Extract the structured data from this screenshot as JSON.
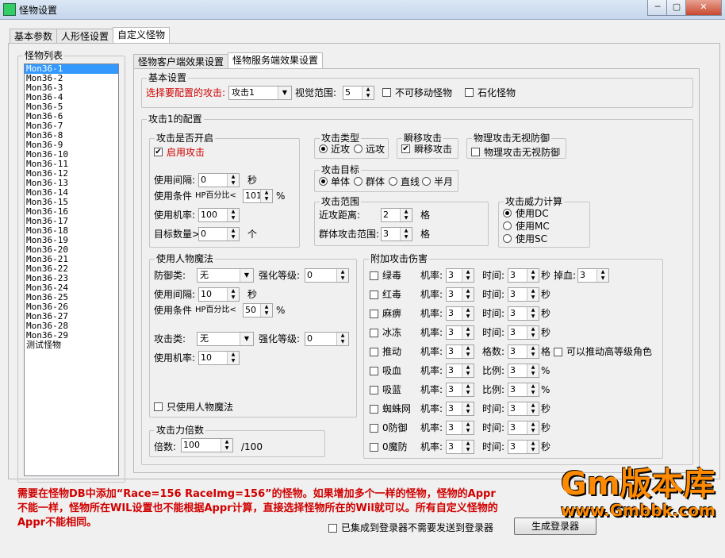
{
  "window": {
    "title": "怪物设置"
  },
  "main_tabs": [
    "基本参数",
    "人形怪设置",
    "自定义怪物"
  ],
  "monster_list": {
    "label": "怪物列表",
    "items": [
      "Mon36-1",
      "Mon36-2",
      "Mon36-3",
      "Mon36-4",
      "Mon36-5",
      "Mon36-6",
      "Mon36-7",
      "Mon36-8",
      "Mon36-9",
      "Mon36-10",
      "Mon36-11",
      "Mon36-12",
      "Mon36-13",
      "Mon36-14",
      "Mon36-15",
      "Mon36-16",
      "Mon36-17",
      "Mon36-18",
      "Mon36-19",
      "Mon36-20",
      "Mon36-21",
      "Mon36-22",
      "Mon36-23",
      "Mon36-24",
      "Mon36-25",
      "Mon36-26",
      "Mon36-27",
      "Mon36-28",
      "Mon36-29",
      "测试怪物"
    ]
  },
  "sub_tabs": [
    "怪物客户端效果设置",
    "怪物服务端效果设置"
  ],
  "basic": {
    "label": "基本设置",
    "select_attack_label": "选择要配置的攻击:",
    "select_attack_value": "攻击1",
    "vision_label": "视觉范围:",
    "vision_value": "5",
    "immobile_label": "不可移动怪物",
    "stone_label": "石化怪物"
  },
  "attack_config": {
    "label": "攻击1的配置",
    "enable_group": {
      "label": "攻击是否开启",
      "enable_label": "启用攻击",
      "interval_label": "使用间隔:",
      "interval_value": "0",
      "interval_unit": "秒",
      "cond_label": "使用条件",
      "cond_mid": "HP百分比<",
      "cond_value": "101",
      "cond_unit": "%",
      "rate_label": "使用机率:",
      "rate_value": "100",
      "targets_label": "目标数量>",
      "targets_value": "0",
      "targets_unit": "个"
    },
    "attack_type": {
      "label": "攻击类型",
      "melee": "近攻",
      "ranged": "远攻"
    },
    "teleport": {
      "label": "瞬移攻击",
      "check_label": "瞬移攻击"
    },
    "ignore_def": {
      "label": "物理攻击无视防御",
      "check_label": "物理攻击无视防御"
    },
    "attack_target": {
      "label": "攻击目标",
      "options": [
        "单体",
        "群体",
        "直线",
        "半月"
      ]
    },
    "attack_range": {
      "label": "攻击范围",
      "near_label": "近攻距离:",
      "near_value": "2",
      "near_unit": "格",
      "group_label": "群体攻击范围:",
      "group_value": "3",
      "group_unit": "格"
    },
    "power": {
      "label": "攻击威力计算",
      "options": [
        "使用DC",
        "使用MC",
        "使用SC"
      ]
    },
    "magic": {
      "label": "使用人物魔法",
      "def_label": "防御类:",
      "def_value": "无",
      "enh1_label": "强化等级:",
      "enh1_value": "0",
      "interval_label": "使用间隔:",
      "interval_value": "10",
      "interval_unit": "秒",
      "cond_label": "使用条件",
      "cond_mid": "HP百分比<",
      "cond_value": "50",
      "cond_unit": "%",
      "atk_label": "攻击类:",
      "atk_value": "无",
      "enh2_label": "强化等级:",
      "enh2_value": "0",
      "rate_label": "使用机率:",
      "rate_value": "10",
      "only_label": "只使用人物魔法"
    },
    "extra": {
      "label": "附加攻击伤害",
      "rows": [
        {
          "name": "绿毒",
          "rate_label": "机率:",
          "rate": "3",
          "l2": "时间:",
          "v2": "3",
          "u2": "秒",
          "l3": "掉血:",
          "v3": "3"
        },
        {
          "name": "红毒",
          "rate_label": "机率:",
          "rate": "3",
          "l2": "时间:",
          "v2": "3",
          "u2": "秒"
        },
        {
          "name": "麻痹",
          "rate_label": "机率:",
          "rate": "3",
          "l2": "时间:",
          "v2": "3",
          "u2": "秒"
        },
        {
          "name": "冰冻",
          "rate_label": "机率:",
          "rate": "3",
          "l2": "时间:",
          "v2": "3",
          "u2": "秒"
        },
        {
          "name": "推动",
          "rate_label": "机率:",
          "rate": "3",
          "l2": "格数:",
          "v2": "3",
          "u2": "格",
          "extra_check": "可以推动高等级角色"
        },
        {
          "name": "吸血",
          "rate_label": "机率:",
          "rate": "3",
          "l2": "比例:",
          "v2": "3",
          "u2": "%"
        },
        {
          "name": "吸蓝",
          "rate_label": "机率:",
          "rate": "3",
          "l2": "比例:",
          "v2": "3",
          "u2": "%"
        },
        {
          "name": "蜘蛛网",
          "rate_label": "机率:",
          "rate": "3",
          "l2": "时间:",
          "v2": "3",
          "u2": "秒"
        },
        {
          "name": "0防御",
          "rate_label": "机率:",
          "rate": "3",
          "l2": "时间:",
          "v2": "3",
          "u2": "秒"
        },
        {
          "name": "0魔防",
          "rate_label": "机率:",
          "rate": "3",
          "l2": "时间:",
          "v2": "3",
          "u2": "秒"
        }
      ]
    },
    "multiplier": {
      "label": "攻击力倍数",
      "field_label": "倍数:",
      "value": "100",
      "unit": "/100"
    }
  },
  "footer": {
    "note": "需要在怪物DB中添加“Race=156 RaceImg=156”的怪物。如果增加多个一样的怪物，怪物的Appr不能一样，怪物所在WIL设置也不能根据Appr计算，直接选择怪物所在的Wil就可以。所有自定义怪物的Appr不能相同。",
    "integrated_label": "已集成到登录器不需要发送到登录器",
    "generate_label": "生成登录器",
    "watermark": "Gm版本库",
    "watermark_url": "www.Gmbbk.com"
  }
}
